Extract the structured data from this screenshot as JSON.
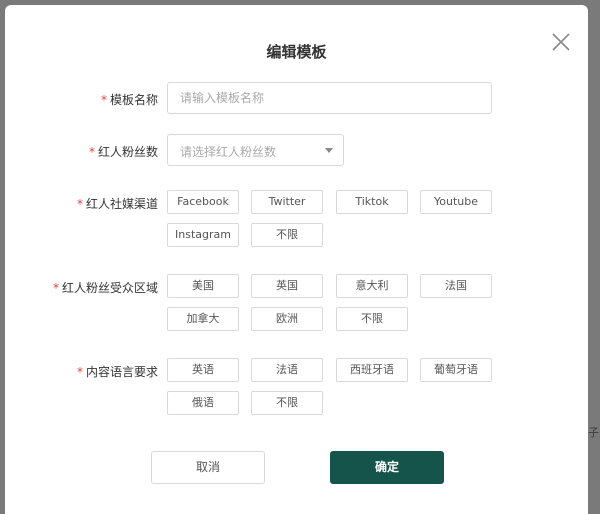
{
  "background_peek_text": "子",
  "modal": {
    "title": "编辑模板",
    "close_icon": "close-icon"
  },
  "form": {
    "required_mark": "*",
    "template_name": {
      "label": "模板名称",
      "placeholder": "请输入模板名称",
      "value": ""
    },
    "fans_count": {
      "label": "红人粉丝数",
      "placeholder": "请选择红人粉丝数"
    },
    "channels": {
      "label": "红人社媒渠道",
      "options": [
        "Facebook",
        "Twitter",
        "Tiktok",
        "Youtube",
        "Instagram",
        "不限"
      ]
    },
    "regions": {
      "label": "红人粉丝受众区域",
      "options": [
        "美国",
        "英国",
        "意大利",
        "法国",
        "加拿大",
        "欧洲",
        "不限"
      ]
    },
    "languages": {
      "label": "内容语言要求",
      "options": [
        "英语",
        "法语",
        "西班牙语",
        "葡萄牙语",
        "俄语",
        "不限"
      ]
    }
  },
  "footer": {
    "cancel_label": "取消",
    "ok_label": "确定"
  },
  "colors": {
    "primary": "#14544b",
    "required": "#e0453a",
    "border": "#d9d9d9"
  }
}
